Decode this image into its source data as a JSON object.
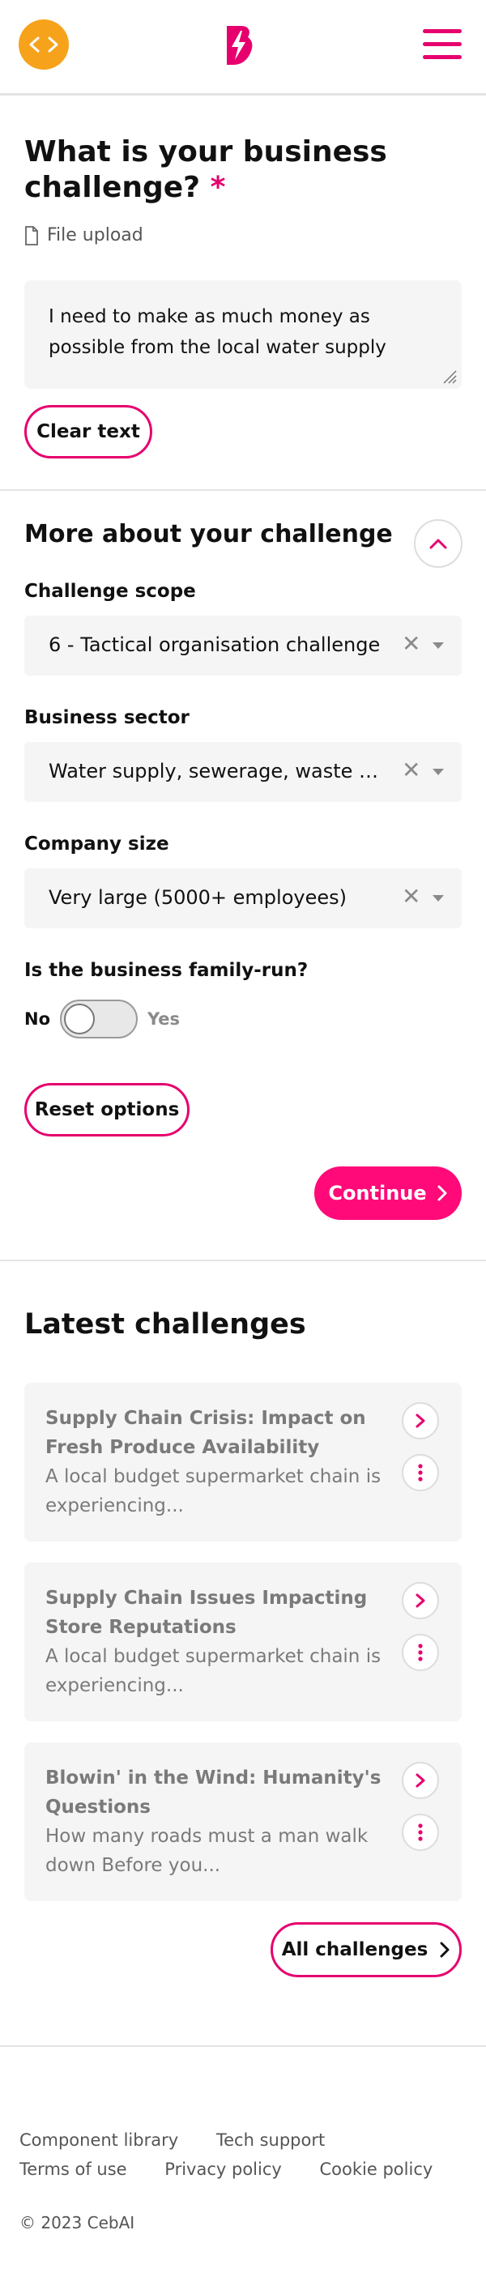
{
  "header": {
    "code_icon": "code-brackets-icon",
    "logo_icon": "bolt-b-logo-icon",
    "menu_icon": "hamburger-menu-icon",
    "colors": {
      "accent": "#e6006e",
      "code_button": "#f7a21b",
      "continue_button": "#ff0a78"
    }
  },
  "challenge": {
    "heading": "What is your business challenge?",
    "required_mark": "*",
    "file_upload_label": "File upload",
    "file_icon": "file-icon",
    "text": "I need to make as much money as possible from the local water supply",
    "clear_label": "Clear text"
  },
  "options": {
    "heading": "More about your challenge",
    "collapse_icon": "chevron-up-icon",
    "scope_label": "Challenge scope",
    "scope_value": "6 - Tactical organisation challenge",
    "sector_label": "Business sector",
    "sector_value": "Water supply, sewerage, waste man...",
    "size_label": "Company size",
    "size_value": "Very large (5000+ employees)",
    "clear_glyph": "✕",
    "family_label": "Is the business family-run?",
    "toggle_no": "No",
    "toggle_yes": "Yes",
    "family_run": false,
    "reset_label": "Reset options",
    "continue_label": "Continue"
  },
  "latest": {
    "heading": "Latest challenges",
    "cards": [
      {
        "title": "Supply Chain Crisis: Impact on Fresh Produce Availability",
        "desc": "A local budget supermarket chain is experiencing..."
      },
      {
        "title": "Supply Chain Issues Impacting Store Reputations",
        "desc": "A local budget supermarket chain is experiencing..."
      },
      {
        "title": "Blowin' in the Wind: Humanity's Questions",
        "desc": "How many roads must a man walk down Before you..."
      }
    ],
    "all_label": "All challenges"
  },
  "footer": {
    "links": [
      "Component library",
      "Tech support",
      "Terms of use",
      "Privacy policy",
      "Cookie policy"
    ],
    "copyright": "© 2023 CebAI"
  }
}
